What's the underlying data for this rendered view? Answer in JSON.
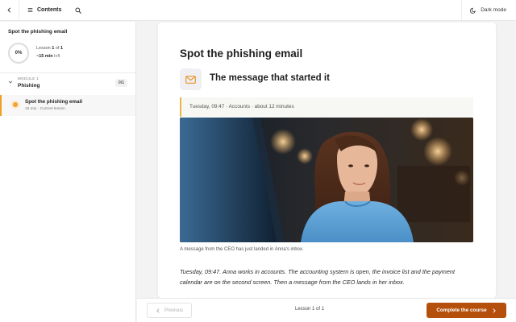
{
  "topbar": {
    "back_icon": "chevron-left-icon",
    "contents_label": "Contents",
    "contents_icon": "list-icon",
    "search_icon": "search-icon",
    "dark_mode_label": "Dark mode",
    "dark_mode_icon": "moon-icon"
  },
  "sidebar": {
    "course_title": "Spot the phishing email",
    "progress_percent": "0%",
    "lesson_prefix": "Lesson ",
    "lesson_current": "1",
    "lesson_of": " of ",
    "lesson_total": "1",
    "time_left": "~15 min",
    "time_suffix": " left",
    "module": {
      "kicker": "MODULE 1",
      "name": "Phishing",
      "count": "0/1"
    },
    "lessons": [
      {
        "title": "Spot the phishing email",
        "meta": "15 min · Current lesson"
      }
    ]
  },
  "main": {
    "lesson_title": "Spot the phishing email",
    "section_icon": "mail-icon",
    "section_title": "The message that started it",
    "callout": "Tuesday, 09:47 · Accounts · about 12 minutes",
    "image_caption": "A message from the CEO has just landed in Anna's inbox.",
    "body": "Tuesday, 09:47. Anna works in accounts. The accounting system is open, the invoice list and the payment calendar are on the second screen. Then a message from the CEO lands in her inbox."
  },
  "footer": {
    "previous_label": "Previous",
    "counter": "Lesson 1 of 1",
    "complete_label": "Complete the course"
  },
  "colors": {
    "accent": "#b5500c",
    "current_dot": "#f2a232",
    "callout_bar": "#e7b54a",
    "mail_icon": "#e8962a"
  }
}
